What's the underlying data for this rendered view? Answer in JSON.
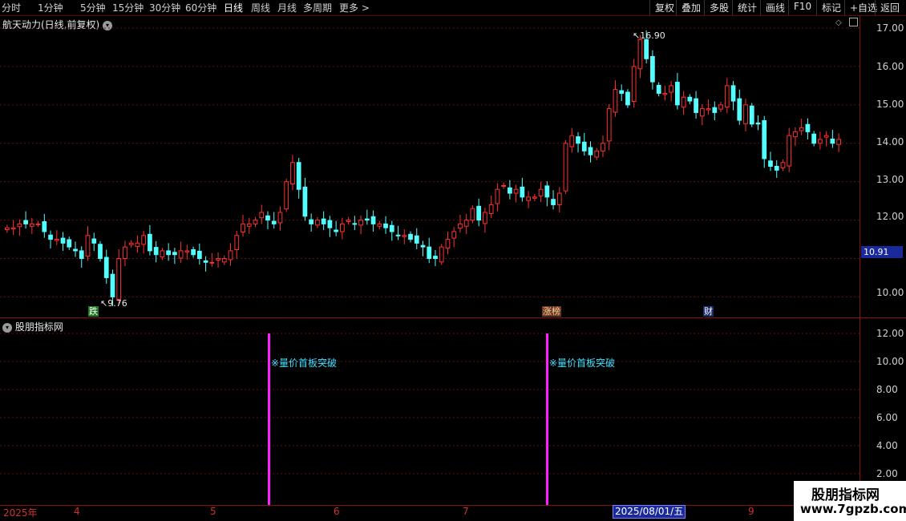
{
  "toolbar": {
    "periods": [
      "分时",
      "1分钟",
      "5分钟",
      "15分钟",
      "30分钟",
      "60分钟",
      "日线",
      "周线",
      "月线",
      "多周期",
      "更多 >"
    ],
    "active": "日线",
    "right_buttons": [
      "复权",
      "叠加",
      "多股",
      "统计",
      "画线",
      "F10",
      "标记",
      "+自选",
      "返回"
    ]
  },
  "main_chart": {
    "title": "航天动力(日线,前复权)",
    "y_axis": [
      "17.00",
      "16.00",
      "15.00",
      "14.00",
      "13.00",
      "12.00",
      "10.00"
    ],
    "current_price": "10.91",
    "high_annotation": "16.90",
    "low_annotation": "9.76",
    "markers": [
      {
        "text": "跌",
        "bg": "#1f7a1f",
        "fg": "#ffffff"
      },
      {
        "text": "涨榜",
        "bg": "#6a3a20",
        "fg": "#ffd0a0"
      },
      {
        "text": "财",
        "bg": "#1a2a6a",
        "fg": "#ffffff"
      }
    ],
    "up_color": "#ff3030",
    "down_color": "#54ffff"
  },
  "indicator": {
    "title": "股朋指标网",
    "y_axis": [
      "12.00",
      "10.00",
      "8.00",
      "6.00",
      "4.00",
      "2.00"
    ],
    "signal_label": "※量价首板突破",
    "signal_color": "#ff20ff"
  },
  "date_axis": {
    "labels": [
      "2025年",
      "4",
      "5",
      "6",
      "7",
      "9"
    ],
    "cursor_date": "2025/08/01/五"
  },
  "watermark": {
    "line1": "股朋指标网",
    "line2": "www.7gpzb.com"
  },
  "chart_data": {
    "type": "candlestick",
    "title": "航天动力(日线,前复权)",
    "ylim": [
      9.5,
      17.2
    ],
    "high": 16.9,
    "low": 9.76,
    "last": 10.91,
    "close_series": [
      11.8,
      11.8,
      11.9,
      11.9,
      11.9,
      11.9,
      11.7,
      11.5,
      11.5,
      11.4,
      11.3,
      11.2,
      11.0,
      11.6,
      11.4,
      11.0,
      10.5,
      10.0,
      11.0,
      11.3,
      11.4,
      11.4,
      11.6,
      11.2,
      11.1,
      11.2,
      11.1,
      11.1,
      11.2,
      11.2,
      11.1,
      11.0,
      10.9,
      10.9,
      11.0,
      11.0,
      11.2,
      11.6,
      11.9,
      11.9,
      12.0,
      12.2,
      12.0,
      11.9,
      12.2,
      13.0,
      13.5,
      12.8,
      12.1,
      11.9,
      12.0,
      11.9,
      11.8,
      11.7,
      11.9,
      12.0,
      11.9,
      12.0,
      12.0,
      11.9,
      11.9,
      11.8,
      11.7,
      11.6,
      11.6,
      11.5,
      11.4,
      11.3,
      11.0,
      11.0,
      11.3,
      11.5,
      11.7,
      11.9,
      12.0,
      12.3,
      12.0,
      12.2,
      12.4,
      12.8,
      12.9,
      12.7,
      12.8,
      12.6,
      12.6,
      12.6,
      12.8,
      12.6,
      12.4,
      12.7,
      14.0,
      14.2,
      14.0,
      13.8,
      13.7,
      13.8,
      14.0,
      14.9,
      15.4,
      15.3,
      15.0,
      16.0,
      16.7,
      16.2,
      15.6,
      15.3,
      15.3,
      15.5,
      15.0,
      15.2,
      15.1,
      14.8,
      14.9,
      14.9,
      14.8,
      15.0,
      15.5,
      15.1,
      14.6,
      15.0,
      14.5,
      14.5,
      13.6,
      13.4,
      13.3,
      13.5,
      14.2,
      14.3,
      14.4,
      14.3,
      14.0,
      14.1,
      14.2,
      14.0,
      14.1
    ],
    "signals": [
      {
        "index": 51,
        "label": "※量价首板突破"
      },
      {
        "index": 100,
        "label": "※量价首板突破"
      }
    ],
    "indicator_ylim": [
      1,
      13
    ]
  }
}
